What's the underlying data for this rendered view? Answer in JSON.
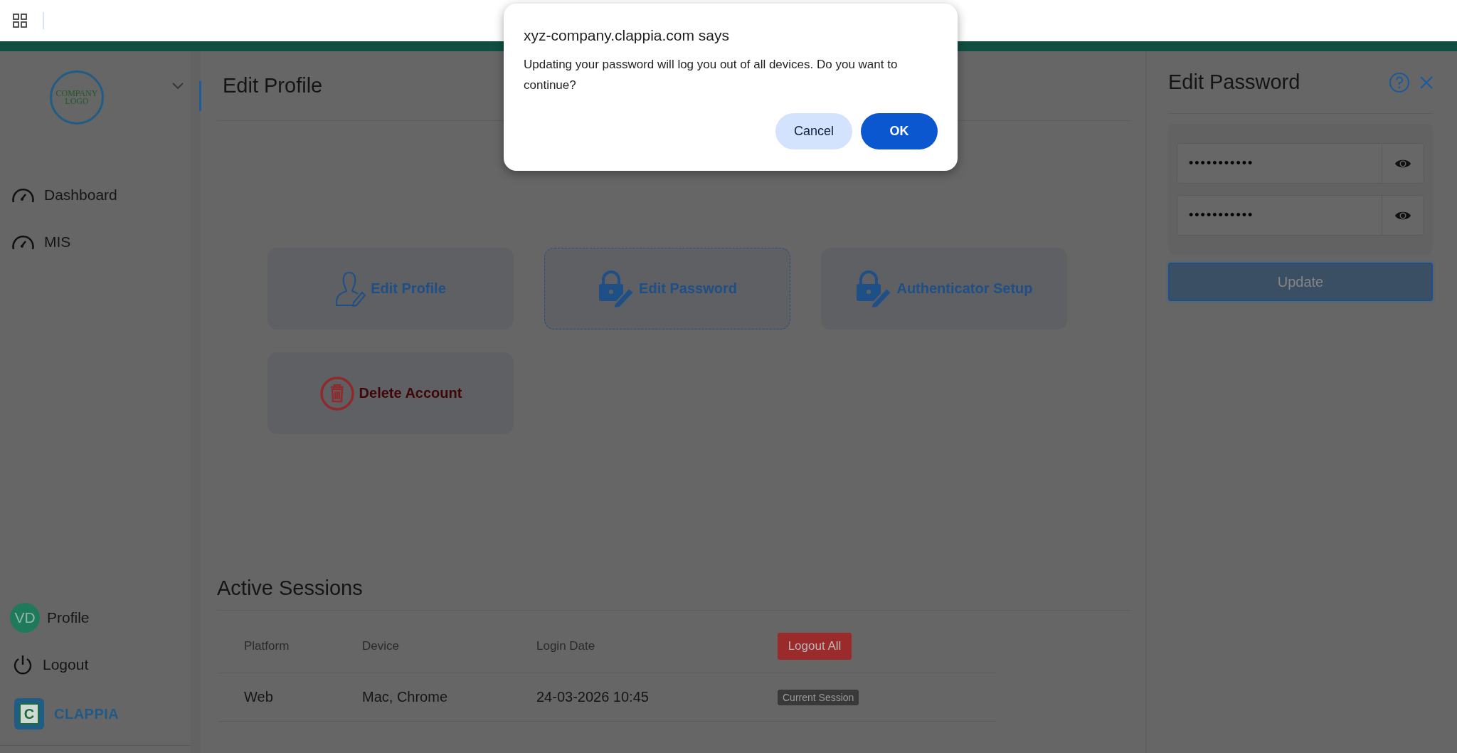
{
  "sidebar": {
    "logo_lines": [
      "COMPANY",
      "LOGO"
    ],
    "nav_items": [
      {
        "label": "Dashboard"
      },
      {
        "label": "MIS"
      }
    ],
    "profile": {
      "initials": "VD",
      "label": "Profile"
    },
    "logout": {
      "label": "Logout"
    },
    "brand": {
      "mark": "C",
      "name": "CLAPPIA"
    }
  },
  "main": {
    "title": "Edit Profile",
    "cards": [
      {
        "label": "Edit Profile",
        "kind": "profile",
        "selected": false
      },
      {
        "label": "Edit Password",
        "kind": "lock",
        "selected": true
      },
      {
        "label": "Authenticator Setup",
        "kind": "lock",
        "selected": false
      },
      {
        "label": "Delete Account",
        "kind": "delete",
        "selected": false
      }
    ]
  },
  "sessions": {
    "title": "Active Sessions",
    "columns": [
      "Platform",
      "Device",
      "Login Date"
    ],
    "action": "Logout All",
    "rows": [
      {
        "cells": [
          "Web",
          "Mac, Chrome",
          "24-03-2026 10:45"
        ],
        "badge": "Current Session"
      }
    ]
  },
  "panel": {
    "title": "Edit Password",
    "fields": [
      {
        "value": "•••••••••••"
      },
      {
        "value": "•••••••••••"
      }
    ],
    "button": {
      "label": "Update",
      "disabled": true
    }
  },
  "dialog": {
    "title": "xyz-company.clappia.com says",
    "message": "Updating your password will log you out of all devices. Do you want to continue?",
    "buttons": [
      {
        "label": "Cancel",
        "kind": "secondary"
      },
      {
        "label": "OK",
        "kind": "primary"
      }
    ]
  }
}
